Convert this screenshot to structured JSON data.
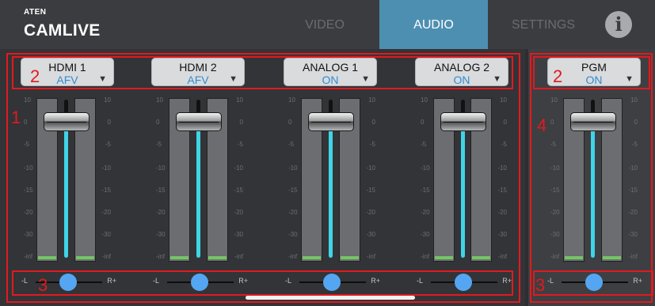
{
  "app": {
    "brand": "ATEN",
    "product": "CAMLIVE"
  },
  "nav": {
    "tabs": [
      {
        "label": "VIDEO",
        "active": false
      },
      {
        "label": "AUDIO",
        "active": true
      },
      {
        "label": "SETTINGS",
        "active": false
      }
    ],
    "info_icon": "info-icon"
  },
  "meter_scale": [
    "10",
    "0",
    "-5",
    "-10",
    "-15",
    "-20",
    "-30",
    "-inf"
  ],
  "channels": [
    {
      "name": "HDMI 1",
      "mode": "AFV",
      "pan_left": "-L",
      "pan_right": "R+"
    },
    {
      "name": "HDMI 2",
      "mode": "AFV",
      "pan_left": "-L",
      "pan_right": "R+"
    },
    {
      "name": "ANALOG 1",
      "mode": "ON",
      "pan_left": "-L",
      "pan_right": "R+"
    },
    {
      "name": "ANALOG 2",
      "mode": "ON",
      "pan_left": "-L",
      "pan_right": "R+"
    }
  ],
  "pgm": {
    "name": "PGM",
    "mode": "ON",
    "pan_left": "-L",
    "pan_right": "R+"
  },
  "annotations": {
    "mixer_label": "1",
    "select_label": "2",
    "pan_label": "3",
    "pgm_label": "4",
    "pgm_select_label": "2",
    "pgm_pan_label": "3",
    "color": "#e11a1f"
  },
  "colors": {
    "accent_tab": "#4d8fb1",
    "mode_text": "#2c8dd6",
    "level_track": "#3fd4e6",
    "peak_led": "#74c565",
    "pan_knob": "#54a6f2"
  }
}
